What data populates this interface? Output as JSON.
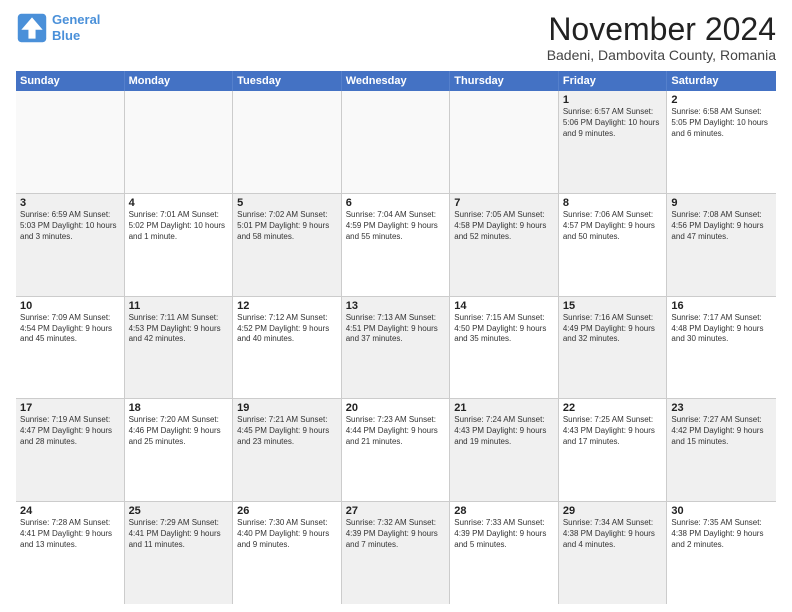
{
  "logo": {
    "line1": "General",
    "line2": "Blue"
  },
  "title": "November 2024",
  "location": "Badeni, Dambovita County, Romania",
  "header_days": [
    "Sunday",
    "Monday",
    "Tuesday",
    "Wednesday",
    "Thursday",
    "Friday",
    "Saturday"
  ],
  "rows": [
    [
      {
        "day": "",
        "info": "",
        "empty": true
      },
      {
        "day": "",
        "info": "",
        "empty": true
      },
      {
        "day": "",
        "info": "",
        "empty": true
      },
      {
        "day": "",
        "info": "",
        "empty": true
      },
      {
        "day": "",
        "info": "",
        "empty": true
      },
      {
        "day": "1",
        "info": "Sunrise: 6:57 AM\nSunset: 5:06 PM\nDaylight: 10 hours\nand 9 minutes.",
        "shaded": true
      },
      {
        "day": "2",
        "info": "Sunrise: 6:58 AM\nSunset: 5:05 PM\nDaylight: 10 hours\nand 6 minutes.",
        "shaded": false
      }
    ],
    [
      {
        "day": "3",
        "info": "Sunrise: 6:59 AM\nSunset: 5:03 PM\nDaylight: 10 hours\nand 3 minutes.",
        "shaded": true
      },
      {
        "day": "4",
        "info": "Sunrise: 7:01 AM\nSunset: 5:02 PM\nDaylight: 10 hours\nand 1 minute.",
        "shaded": false
      },
      {
        "day": "5",
        "info": "Sunrise: 7:02 AM\nSunset: 5:01 PM\nDaylight: 9 hours\nand 58 minutes.",
        "shaded": true
      },
      {
        "day": "6",
        "info": "Sunrise: 7:04 AM\nSunset: 4:59 PM\nDaylight: 9 hours\nand 55 minutes.",
        "shaded": false
      },
      {
        "day": "7",
        "info": "Sunrise: 7:05 AM\nSunset: 4:58 PM\nDaylight: 9 hours\nand 52 minutes.",
        "shaded": true
      },
      {
        "day": "8",
        "info": "Sunrise: 7:06 AM\nSunset: 4:57 PM\nDaylight: 9 hours\nand 50 minutes.",
        "shaded": false
      },
      {
        "day": "9",
        "info": "Sunrise: 7:08 AM\nSunset: 4:56 PM\nDaylight: 9 hours\nand 47 minutes.",
        "shaded": true
      }
    ],
    [
      {
        "day": "10",
        "info": "Sunrise: 7:09 AM\nSunset: 4:54 PM\nDaylight: 9 hours\nand 45 minutes.",
        "shaded": false
      },
      {
        "day": "11",
        "info": "Sunrise: 7:11 AM\nSunset: 4:53 PM\nDaylight: 9 hours\nand 42 minutes.",
        "shaded": true
      },
      {
        "day": "12",
        "info": "Sunrise: 7:12 AM\nSunset: 4:52 PM\nDaylight: 9 hours\nand 40 minutes.",
        "shaded": false
      },
      {
        "day": "13",
        "info": "Sunrise: 7:13 AM\nSunset: 4:51 PM\nDaylight: 9 hours\nand 37 minutes.",
        "shaded": true
      },
      {
        "day": "14",
        "info": "Sunrise: 7:15 AM\nSunset: 4:50 PM\nDaylight: 9 hours\nand 35 minutes.",
        "shaded": false
      },
      {
        "day": "15",
        "info": "Sunrise: 7:16 AM\nSunset: 4:49 PM\nDaylight: 9 hours\nand 32 minutes.",
        "shaded": true
      },
      {
        "day": "16",
        "info": "Sunrise: 7:17 AM\nSunset: 4:48 PM\nDaylight: 9 hours\nand 30 minutes.",
        "shaded": false
      }
    ],
    [
      {
        "day": "17",
        "info": "Sunrise: 7:19 AM\nSunset: 4:47 PM\nDaylight: 9 hours\nand 28 minutes.",
        "shaded": true
      },
      {
        "day": "18",
        "info": "Sunrise: 7:20 AM\nSunset: 4:46 PM\nDaylight: 9 hours\nand 25 minutes.",
        "shaded": false
      },
      {
        "day": "19",
        "info": "Sunrise: 7:21 AM\nSunset: 4:45 PM\nDaylight: 9 hours\nand 23 minutes.",
        "shaded": true
      },
      {
        "day": "20",
        "info": "Sunrise: 7:23 AM\nSunset: 4:44 PM\nDaylight: 9 hours\nand 21 minutes.",
        "shaded": false
      },
      {
        "day": "21",
        "info": "Sunrise: 7:24 AM\nSunset: 4:43 PM\nDaylight: 9 hours\nand 19 minutes.",
        "shaded": true
      },
      {
        "day": "22",
        "info": "Sunrise: 7:25 AM\nSunset: 4:43 PM\nDaylight: 9 hours\nand 17 minutes.",
        "shaded": false
      },
      {
        "day": "23",
        "info": "Sunrise: 7:27 AM\nSunset: 4:42 PM\nDaylight: 9 hours\nand 15 minutes.",
        "shaded": true
      }
    ],
    [
      {
        "day": "24",
        "info": "Sunrise: 7:28 AM\nSunset: 4:41 PM\nDaylight: 9 hours\nand 13 minutes.",
        "shaded": false
      },
      {
        "day": "25",
        "info": "Sunrise: 7:29 AM\nSunset: 4:41 PM\nDaylight: 9 hours\nand 11 minutes.",
        "shaded": true
      },
      {
        "day": "26",
        "info": "Sunrise: 7:30 AM\nSunset: 4:40 PM\nDaylight: 9 hours\nand 9 minutes.",
        "shaded": false
      },
      {
        "day": "27",
        "info": "Sunrise: 7:32 AM\nSunset: 4:39 PM\nDaylight: 9 hours\nand 7 minutes.",
        "shaded": true
      },
      {
        "day": "28",
        "info": "Sunrise: 7:33 AM\nSunset: 4:39 PM\nDaylight: 9 hours\nand 5 minutes.",
        "shaded": false
      },
      {
        "day": "29",
        "info": "Sunrise: 7:34 AM\nSunset: 4:38 PM\nDaylight: 9 hours\nand 4 minutes.",
        "shaded": true
      },
      {
        "day": "30",
        "info": "Sunrise: 7:35 AM\nSunset: 4:38 PM\nDaylight: 9 hours\nand 2 minutes.",
        "shaded": false
      }
    ]
  ]
}
